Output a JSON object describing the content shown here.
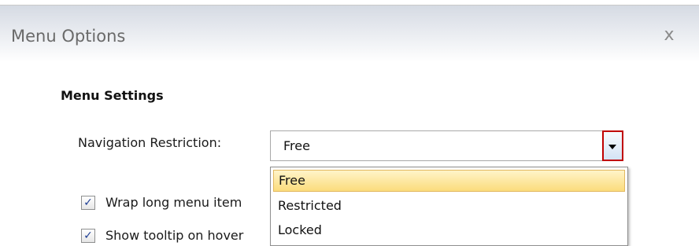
{
  "window": {
    "title": "Menu Options",
    "close_glyph": "x"
  },
  "section": {
    "title": "Menu Settings"
  },
  "navigation": {
    "label": "Navigation Restriction:",
    "selected_value": "Free",
    "options": [
      "Free",
      "Restricted",
      "Locked"
    ],
    "highlighted_option": "Free"
  },
  "checkboxes": [
    {
      "label": "Wrap long menu item",
      "checked": true
    },
    {
      "label": "Show tooltip on hover",
      "checked": true
    }
  ],
  "icons": {
    "close": "close-icon",
    "dropdown_arrow": "chevron-down-icon",
    "checkmark": "checkmark-icon"
  },
  "colors": {
    "titlebar_top": "#d5dae3",
    "highlight_top": "#fff4c9",
    "highlight_bottom": "#fbdc7c",
    "arrow_focus_border": "#c00000",
    "checkmark": "#1e3e93"
  }
}
